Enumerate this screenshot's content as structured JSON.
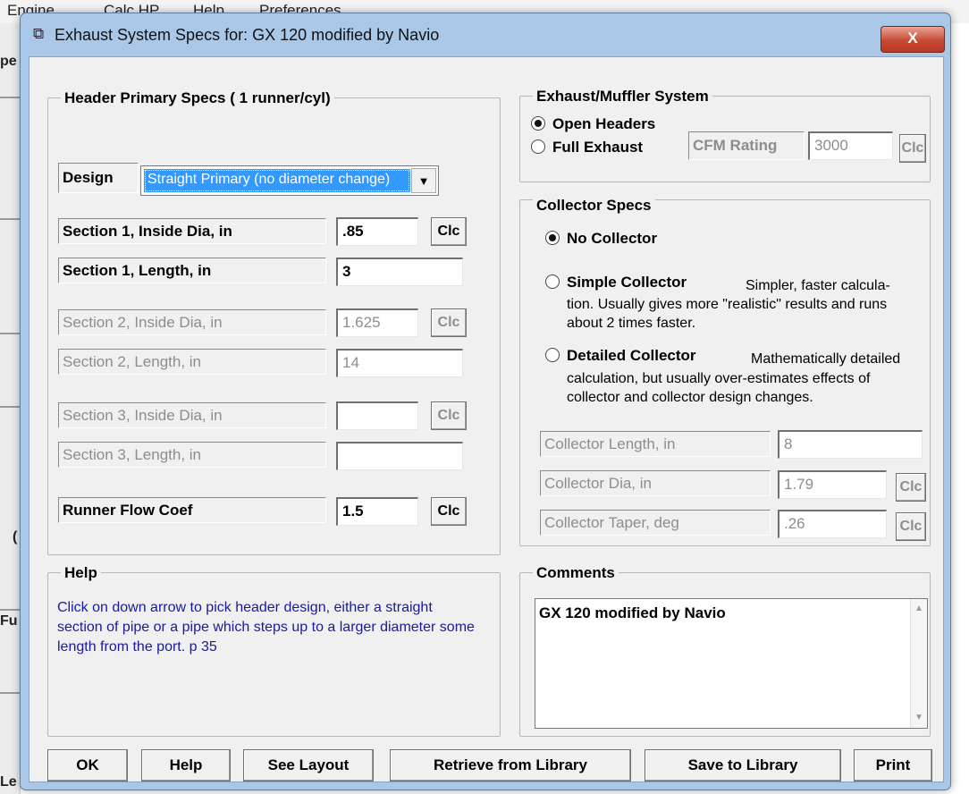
{
  "background_app": {
    "menu": [
      "Engine",
      "Calc HP",
      "Help",
      "Preferences"
    ],
    "left_fragments": [
      "pe",
      "(",
      "Fu",
      "Le"
    ]
  },
  "window": {
    "title": "Exhaust System Specs for: GX 120 modified by Navio",
    "title_icon": "window-icon",
    "close_label": "X"
  },
  "header": {
    "title": "Header Primary Specs ( 1 runner/cyl)",
    "design_label": "Design",
    "design_value": "Straight Primary (no diameter change)",
    "dropdown_arrow": "▼",
    "rows": [
      {
        "label": "Section 1, Inside Dia, in",
        "value": ".85",
        "clc": "Clc",
        "enabled": true
      },
      {
        "label": "Section 1, Length, in",
        "value": "3",
        "enabled": true
      },
      {
        "label": "Section 2, Inside Dia, in",
        "value": "1.625",
        "clc": "Clc",
        "enabled": false
      },
      {
        "label": "Section 2, Length, in",
        "value": "14",
        "enabled": false
      },
      {
        "label": "Section 3, Inside Dia, in",
        "value": "",
        "clc": "Clc",
        "enabled": false
      },
      {
        "label": "Section 3, Length, in",
        "value": "",
        "enabled": false
      },
      {
        "label": "Runner Flow Coef",
        "value": "1.5",
        "clc": "Clc",
        "enabled": true
      }
    ]
  },
  "exhaust": {
    "title": "Exhaust/Muffler System",
    "options": [
      {
        "label": "Open Headers",
        "selected": true
      },
      {
        "label": "Full Exhaust",
        "selected": false
      }
    ],
    "cfm_label": "CFM Rating",
    "cfm_value": "3000",
    "clc": "Clc"
  },
  "collector": {
    "title": "Collector Specs",
    "options": [
      {
        "label": "No Collector",
        "selected": true,
        "desc": ""
      },
      {
        "label": "Simple Collector",
        "selected": false,
        "desc_inline": "Simpler, faster calcula-",
        "desc": "tion.  Usually gives more \"realistic\" results and runs about 2 times faster."
      },
      {
        "label": "Detailed Collector",
        "selected": false,
        "desc_inline": "Mathematically detailed",
        "desc": "calculation, but usually over-estimates effects of collector and collector design changes."
      }
    ],
    "fields": [
      {
        "label": "Collector Length, in",
        "value": "8"
      },
      {
        "label": "Collector Dia, in",
        "value": "1.79",
        "clc": "Clc"
      },
      {
        "label": "Collector Taper, deg",
        "value": ".26",
        "clc": "Clc"
      }
    ]
  },
  "help": {
    "title": "Help",
    "text": "Click on down arrow to pick header design, either a straight section of pipe or a pipe which steps up to a larger diameter some length from the port.  p 35"
  },
  "comments": {
    "title": "Comments",
    "text": "GX 120 modified by Navio",
    "scroll_up": "▲",
    "scroll_down": "▼"
  },
  "buttons": [
    "OK",
    "Help",
    "See Layout",
    "Retrieve from Library",
    "Save to Library",
    "Print"
  ],
  "colors": {
    "title_bar": "#a9c8e8",
    "selection": "#3399ff",
    "help_text": "#1a1a9e",
    "close_button": "#c74a35"
  }
}
